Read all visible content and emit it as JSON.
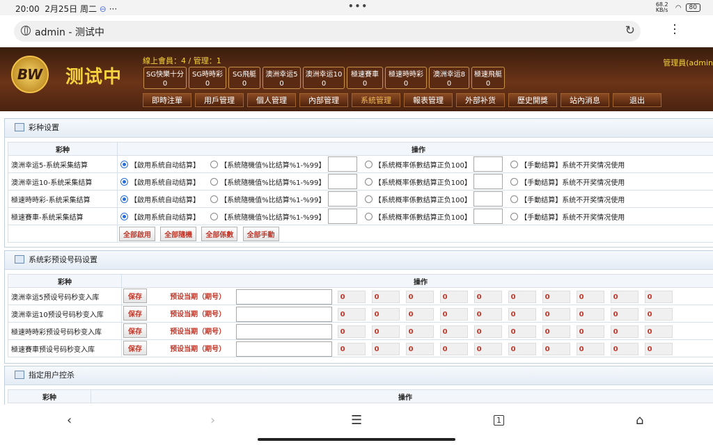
{
  "status": {
    "time": "20:00",
    "date": "2月25日 周二",
    "net_speed": "68.2 KB/s",
    "battery": "80"
  },
  "browser": {
    "url": "admin - 测试中",
    "reload_icon": "reload-icon"
  },
  "header": {
    "logo_text": "BW",
    "site_name": "测试中",
    "online": "線上會員：4 / 管理：1",
    "admin_label": "管理員(admin",
    "lottery_tabs": [
      {
        "name": "SG快樂十分",
        "count": "0"
      },
      {
        "name": "SG時時彩",
        "count": "0"
      },
      {
        "name": "SG飛艇",
        "count": "0"
      },
      {
        "name": "澳洲幸运5",
        "count": "0"
      },
      {
        "name": "澳洲幸运10",
        "count": "0"
      },
      {
        "name": "極速賽車",
        "count": "0"
      },
      {
        "name": "極速時時彩",
        "count": "0"
      },
      {
        "name": "澳洲幸运8",
        "count": "0"
      },
      {
        "name": "極速飛艇",
        "count": "0"
      }
    ],
    "nav": [
      "即時注單",
      "用戶管理",
      "個人管理",
      "內部管理",
      "系統管理",
      "報表管理",
      "外部补货",
      "歷史開獎",
      "站內消息",
      "退出"
    ]
  },
  "panel1": {
    "title": "彩种设置",
    "col_lottery": "彩种",
    "col_action": "操作",
    "opt_auto": "【啟用系統自动结算】",
    "opt_random": "【系統隨機值%比结算%1-%99】",
    "opt_coef": "【系統概率係數结算正负100】",
    "opt_manual": "【手動结算】系统不开奖情况使用",
    "rows": [
      "澳洲幸运5-系统采集结算",
      "澳洲幸运10-系统采集结算",
      "極速時時彩-系统采集结算",
      "極速賽車-系统采集结算"
    ],
    "buttons": [
      "全部啟用",
      "全部隨機",
      "全部係數",
      "全部手動"
    ]
  },
  "panel2": {
    "title": "系统彩预设号码设置",
    "col_lottery": "彩种",
    "col_action": "操作",
    "save_label": "保存",
    "preset_label": "预设当期（期号）",
    "rows": [
      {
        "name": "澳洲幸运5预设号码秒变入库",
        "values": [
          "0",
          "0",
          "0",
          "0",
          "0",
          "0",
          "0",
          "0",
          "0",
          "0"
        ]
      },
      {
        "name": "澳洲幸运10预设号码秒变入库",
        "values": [
          "0",
          "0",
          "0",
          "0",
          "0",
          "0",
          "0",
          "0",
          "0",
          "0"
        ]
      },
      {
        "name": "極速時時彩预设号码秒变入库",
        "values": [
          "0",
          "0",
          "0",
          "0",
          "0",
          "0",
          "0",
          "0",
          "0",
          "0"
        ]
      },
      {
        "name": "極速賽車预设号码秒变入库",
        "values": [
          "0",
          "0",
          "0",
          "0",
          "0",
          "0",
          "0",
          "0",
          "0",
          "0"
        ]
      }
    ]
  },
  "panel3": {
    "title": "指定用户控杀",
    "col_lottery": "彩种",
    "col_action": "操作"
  }
}
